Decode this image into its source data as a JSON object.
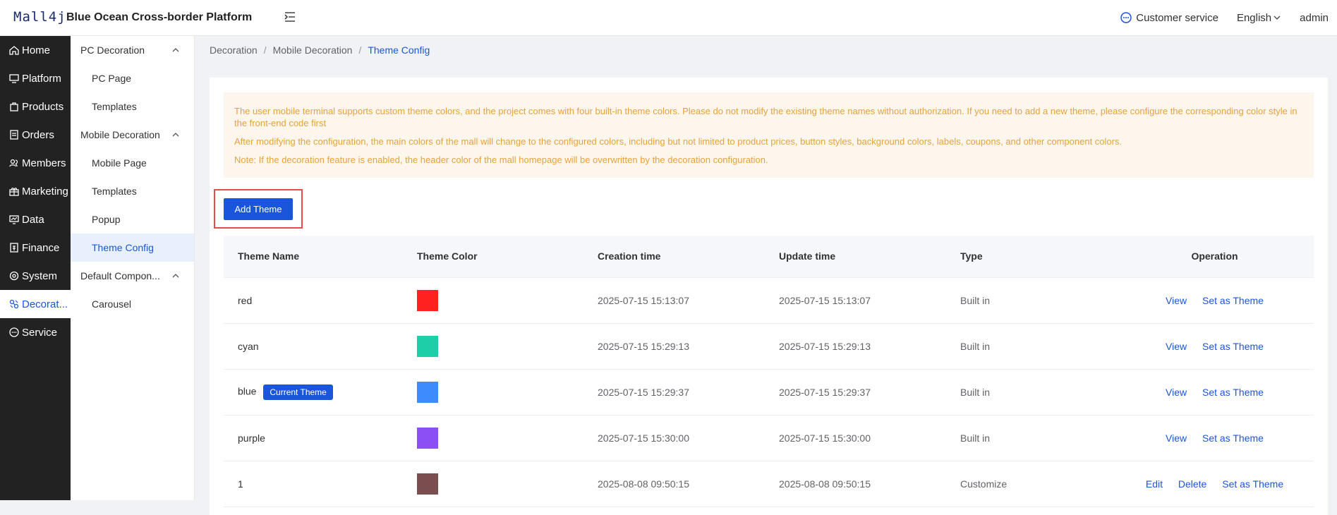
{
  "header": {
    "logo": "Mall4j",
    "title": "Blue Ocean Cross-border Platform",
    "customer_service": "Customer service",
    "language": "English",
    "user": "admin"
  },
  "leftnav": [
    {
      "label": "Home",
      "icon": "home-icon"
    },
    {
      "label": "Platform",
      "icon": "monitor-icon"
    },
    {
      "label": "Products",
      "icon": "bag-icon"
    },
    {
      "label": "Orders",
      "icon": "document-icon"
    },
    {
      "label": "Members",
      "icon": "users-icon"
    },
    {
      "label": "Marketing",
      "icon": "gift-icon"
    },
    {
      "label": "Data",
      "icon": "chart-icon"
    },
    {
      "label": "Finance",
      "icon": "finance-icon"
    },
    {
      "label": "System",
      "icon": "gear-icon"
    },
    {
      "label": "Decorat...",
      "icon": "palette-icon"
    },
    {
      "label": "Service",
      "icon": "chat-icon"
    }
  ],
  "subnav": {
    "pc_group": "PC Decoration",
    "pc_page": "PC Page",
    "pc_templates": "Templates",
    "mobile_group": "Mobile Decoration",
    "mobile_page": "Mobile Page",
    "mobile_templates": "Templates",
    "popup": "Popup",
    "theme_config": "Theme Config",
    "default_group": "Default Compon...",
    "carousel": "Carousel"
  },
  "breadcrumb": {
    "level1": "Decoration",
    "level2": "Mobile Decoration",
    "level3": "Theme Config",
    "sep": "/"
  },
  "notice": {
    "line1": "The user mobile terminal supports custom theme colors, and the project comes with four built-in theme colors. Please do not modify the existing theme names without authorization. If you need to add a new theme, please configure the corresponding color style in the front-end code first",
    "line2": "After modifying the configuration, the main colors of the mall will change to the configured colors, including but not limited to product prices, button styles, background colors, labels, coupons, and other component colors.",
    "line3": "Note: If the decoration feature is enabled, the header color of the mall homepage will be overwritten by the decoration configuration."
  },
  "add_button": "Add Theme",
  "table": {
    "headers": {
      "name": "Theme Name",
      "color": "Theme Color",
      "created": "Creation time",
      "updated": "Update time",
      "type": "Type",
      "operation": "Operation"
    },
    "current_badge": "Current Theme",
    "op_view": "View",
    "op_set": "Set as Theme",
    "op_edit": "Edit",
    "op_delete": "Delete",
    "rows": [
      {
        "name": "red",
        "color": "#ff2020",
        "created": "2025-07-15 15:13:07",
        "updated": "2025-07-15 15:13:07",
        "type": "Built in"
      },
      {
        "name": "cyan",
        "color": "#1ccfa8",
        "created": "2025-07-15 15:29:13",
        "updated": "2025-07-15 15:29:13",
        "type": "Built in"
      },
      {
        "name": "blue",
        "color": "#3d8bfd",
        "created": "2025-07-15 15:29:37",
        "updated": "2025-07-15 15:29:37",
        "type": "Built in"
      },
      {
        "name": "purple",
        "color": "#8b4ff5",
        "created": "2025-07-15 15:30:00",
        "updated": "2025-07-15 15:30:00",
        "type": "Built in"
      },
      {
        "name": "1",
        "color": "#7a4e4e",
        "created": "2025-08-08 09:50:15",
        "updated": "2025-08-08 09:50:15",
        "type": "Customize"
      }
    ]
  },
  "colors": {
    "accent": "#1a56db",
    "sidebar_bg": "#222222",
    "notice_bg": "#fdf6ec",
    "notice_text": "#e6a23c"
  }
}
